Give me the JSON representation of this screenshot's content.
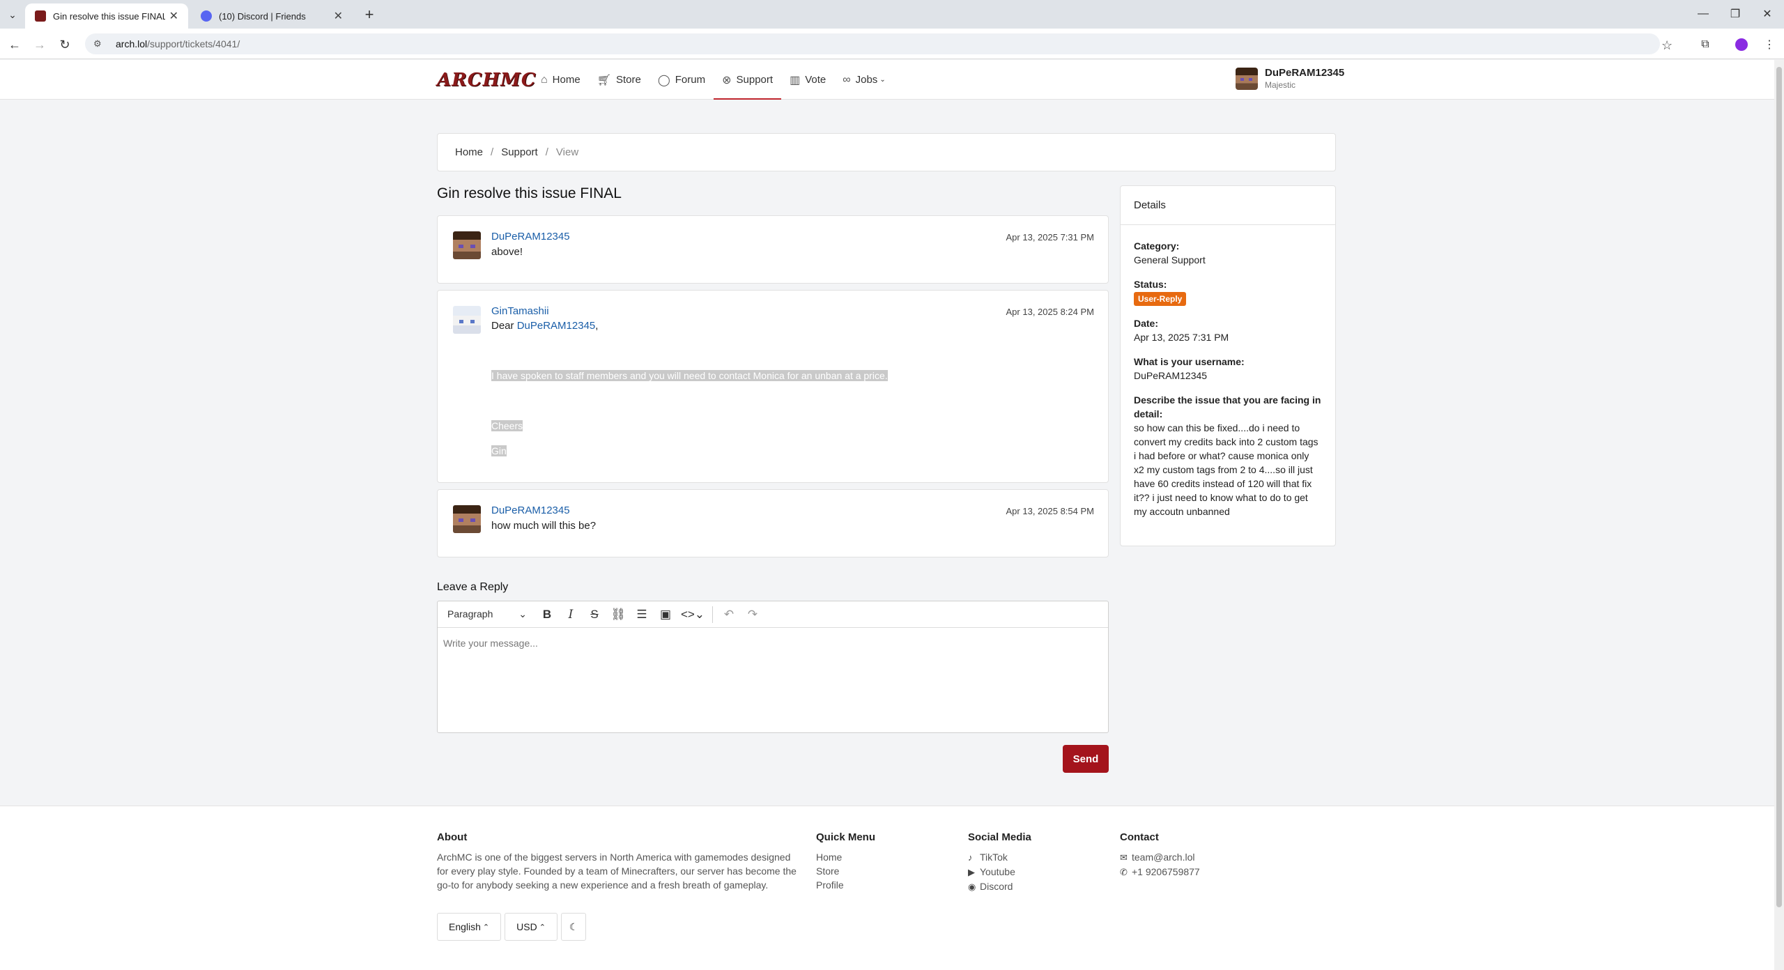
{
  "browser": {
    "tabs": [
      {
        "title": "Gin resolve this issue FINAL - A",
        "active": true
      },
      {
        "title": "(10) Discord | Friends",
        "active": false
      }
    ],
    "url_host": "arch.lol",
    "url_path": "/support/tickets/4041/"
  },
  "header": {
    "logo": "ARCHMC",
    "nav": [
      {
        "label": "Home",
        "icon": "home-icon"
      },
      {
        "label": "Store",
        "icon": "cart-icon"
      },
      {
        "label": "Forum",
        "icon": "chat-icon"
      },
      {
        "label": "Support",
        "icon": "support-icon",
        "active": true
      },
      {
        "label": "Vote",
        "icon": "poll-icon"
      },
      {
        "label": "Jobs",
        "icon": "link-icon"
      }
    ],
    "user": {
      "name": "DuPeRAM12345",
      "rank": "Majestic"
    }
  },
  "breadcrumb": [
    "Home",
    "Support",
    "View"
  ],
  "ticket": {
    "title": "Gin resolve this issue FINAL",
    "messages": [
      {
        "author": "DuPeRAM12345",
        "date": "Apr 13, 2025 7:31 PM",
        "text": "above!"
      },
      {
        "author": "GinTamashii",
        "date": "Apr 13, 2025 8:24 PM",
        "greeting": "Dear",
        "mention": "DuPeRAM12345",
        "greeting_end": ",",
        "line1": "I have spoken to staff members and you will need to contact Monica for an unban at a price.",
        "line2": "Cheers",
        "line3": "Gin"
      },
      {
        "author": "DuPeRAM12345",
        "date": "Apr 13, 2025 8:54 PM",
        "text": "how much will this be?"
      }
    ]
  },
  "details": {
    "heading": "Details",
    "category_label": "Category:",
    "category": "General Support",
    "status_label": "Status:",
    "status": "User-Reply",
    "date_label": "Date:",
    "date": "Apr 13, 2025 7:31 PM",
    "username_label": "What is your username:",
    "username": "DuPeRAM12345",
    "issue_label": "Describe the issue that you are facing in detail:",
    "issue": "so how can this be fixed....do i need to convert my credits back into 2 custom tags i had before or what? cause monica only x2 my custom tags from 2 to 4....so ill just have 60 credits instead of 120 will that fix it?? i just need to know what to do to get my accoutn unbanned"
  },
  "reply": {
    "title": "Leave a Reply",
    "format": "Paragraph",
    "placeholder": "Write your message...",
    "send": "Send"
  },
  "footer": {
    "about_heading": "About",
    "about_text": "ArchMC is one of the biggest servers in North America with gamemodes designed for every play style. Founded by a team of Minecrafters, our server has become the go-to for anybody seeking a new experience and a fresh breath of gameplay.",
    "quick_heading": "Quick Menu",
    "quick": [
      "Home",
      "Store",
      "Profile"
    ],
    "social_heading": "Social Media",
    "social": [
      "TikTok",
      "Youtube",
      "Discord"
    ],
    "contact_heading": "Contact",
    "email": "team@arch.lol",
    "phone": "+1 9206759877",
    "language": "English",
    "currency": "USD"
  },
  "colors": {
    "accent": "#a4141c",
    "link": "#1a5ea8",
    "badge": "#e76a10"
  }
}
